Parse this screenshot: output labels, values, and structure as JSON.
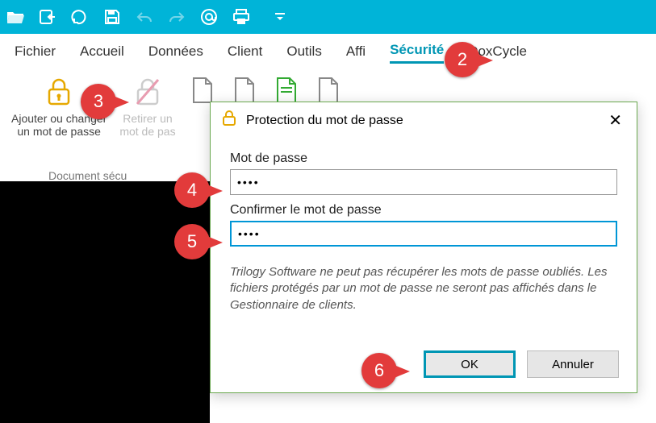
{
  "menu": {
    "items": [
      "Fichier",
      "Accueil",
      "Données",
      "Client",
      "Outils",
      "Affi",
      "Sécurité",
      "DoxCycle"
    ],
    "active_index": 6
  },
  "ribbon": {
    "add_change": {
      "line1": "Ajouter ou changer",
      "line2": "un mot de passe"
    },
    "remove": {
      "line1": "Retirer un",
      "line2": "mot de pas"
    },
    "group_caption": "Document sécu"
  },
  "dialog": {
    "title": "Protection du mot de passe",
    "password_label": "Mot de passe",
    "password_value": "••••",
    "confirm_label": "Confirmer le mot de passe",
    "confirm_value": "••••",
    "warning": "Trilogy Software ne peut pas récupérer les mots de passe oubliés. Les fichiers protégés par un mot de passe ne seront pas affichés dans le Gestionnaire de clients.",
    "ok": "OK",
    "cancel": "Annuler"
  },
  "pins": {
    "p2": "2",
    "p3": "3",
    "p4": "4",
    "p5": "5",
    "p6": "6"
  }
}
